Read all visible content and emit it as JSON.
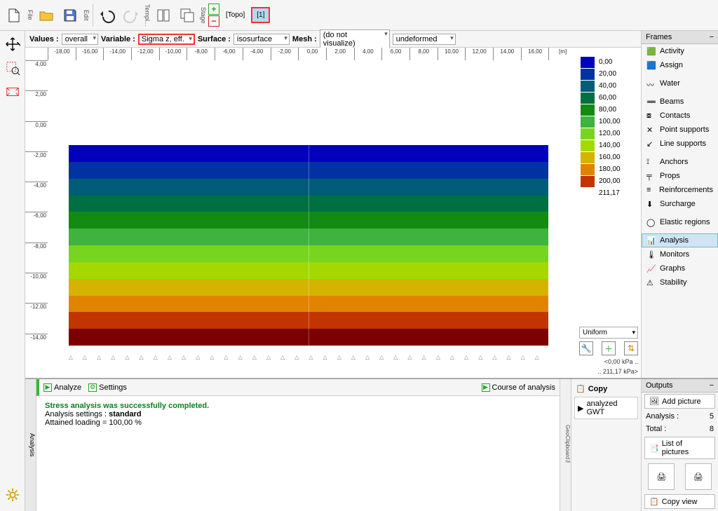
{
  "toolbar": {
    "file_label": "File",
    "edit_label": "Edit",
    "templ_label": "Templ...",
    "stage_label": "Stage",
    "topo_text": "[Topo]",
    "stage1_text": "[1]"
  },
  "options": {
    "values_label": "Values :",
    "values_value": "overall",
    "variable_label": "Variable :",
    "variable_value": "Sigma z, eff.",
    "surface_label": "Surface :",
    "surface_value": "isosurface",
    "mesh_label": "Mesh :",
    "mesh_value": "(do not visualize)",
    "deform_value": "undeformed"
  },
  "x_ruler": [
    "-18,00",
    "-16,00",
    "-14,00",
    "-12,00",
    "-10,00",
    "-8,00",
    "-6,00",
    "-4,00",
    "-2,00",
    "0,00",
    "2,00",
    "4,00",
    "6,00",
    "8,00",
    "10,00",
    "12,00",
    "14,00",
    "16,00",
    "[m]"
  ],
  "y_ruler": [
    "4,00",
    "2,00",
    "0,00",
    "-2,00",
    "-4,00",
    "-6,00",
    "-8,00",
    "-10,00",
    "-12,00",
    "-14,00"
  ],
  "legend_values": [
    "0,00",
    "20,00",
    "40,00",
    "60,00",
    "80,00",
    "100,00",
    "120,00",
    "140,00",
    "160,00",
    "180,00",
    "200,00",
    "211,17"
  ],
  "legend_colors": [
    "#0000bd",
    "#0033a1",
    "#005c77",
    "#007040",
    "#138a13",
    "#3fb23f",
    "#78d421",
    "#a4d900",
    "#d4b400",
    "#e08400",
    "#c23400",
    "#7d0000"
  ],
  "legend_controls": {
    "mode": "Uniform",
    "range_low": "<0,00 kPa ..",
    "range_high": ".. 211,17 kPa>"
  },
  "frames": {
    "title": "Frames",
    "items": [
      "Activity",
      "Assign",
      "Water",
      "Beams",
      "Contacts",
      "Point supports",
      "Line supports",
      "Anchors",
      "Props",
      "Reinforcements",
      "Surcharge",
      "Elastic regions",
      "Analysis",
      "Monitors",
      "Graphs",
      "Stability"
    ],
    "active": "Analysis"
  },
  "analysis": {
    "tab_label": "Analysis",
    "analyze_btn": "Analyze",
    "settings_btn": "Settings",
    "course_btn": "Course of analysis",
    "success_msg": "Stress analysis was successfully completed.",
    "settings_line": "Analysis settings : ",
    "settings_val": "standard",
    "loading_line": "Attained loading = 100,00 %"
  },
  "copy": {
    "title": "Copy",
    "item1": "analyzed GWT",
    "geo_label": "GeoClipboard™"
  },
  "outputs": {
    "title": "Outputs",
    "add_pic": "Add picture",
    "analysis_label": "Analysis :",
    "analysis_count": "5",
    "total_label": "Total :",
    "total_count": "8",
    "list_pics": "List of pictures",
    "copy_view": "Copy view"
  },
  "chart_data": {
    "type": "heatmap",
    "title": "Sigma z, eff.",
    "xlabel": "[m]",
    "x_range": [
      -18,
      18
    ],
    "y_range": [
      -15,
      4
    ],
    "value_range_kpa": [
      0,
      211.17
    ],
    "bands_depth_to_value": [
      {
        "depth_top": 0.0,
        "value": 0.0
      },
      {
        "depth_top": -1.0,
        "value": 20.0
      },
      {
        "depth_top": -2.0,
        "value": 40.0
      },
      {
        "depth_top": -3.0,
        "value": 60.0
      },
      {
        "depth_top": -4.0,
        "value": 80.0
      },
      {
        "depth_top": -5.5,
        "value": 100.0
      },
      {
        "depth_top": -7.0,
        "value": 120.0
      },
      {
        "depth_top": -8.5,
        "value": 140.0
      },
      {
        "depth_top": -10.0,
        "value": 160.0
      },
      {
        "depth_top": -11.5,
        "value": 180.0
      },
      {
        "depth_top": -13.0,
        "value": 200.0
      },
      {
        "depth_top": -14.5,
        "value": 211.17
      }
    ]
  }
}
